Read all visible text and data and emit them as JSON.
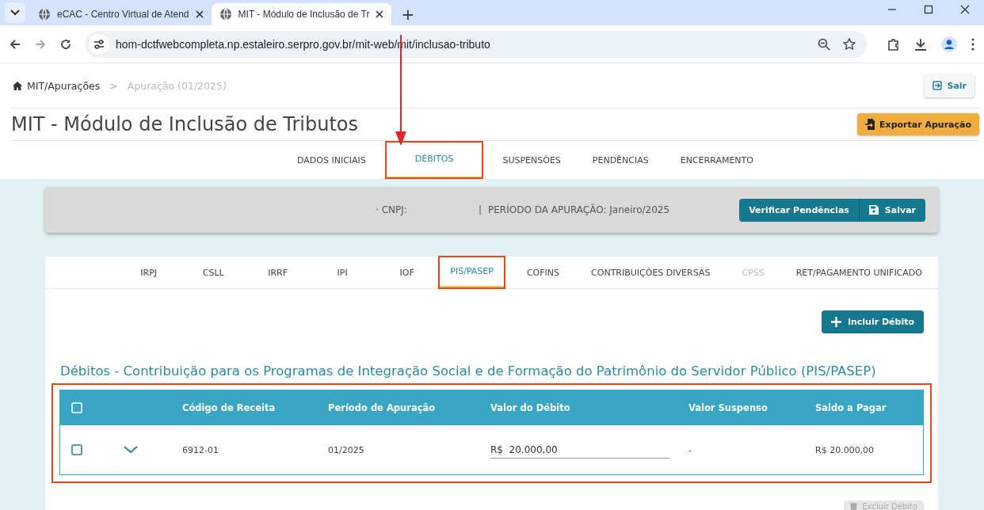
{
  "browser": {
    "tabs": [
      {
        "title": "eCAC - Centro Virtual de Atend",
        "selected": false
      },
      {
        "title": "MIT - Módulo de Inclusão de Tr",
        "selected": true
      }
    ],
    "new_tab": "+",
    "address": "hom-dctfwebcompleta.np.estaleiro.serpro.gov.br/mit-web/mit/inclusao-tributo"
  },
  "breadcrumb": [
    {
      "label": "MIT/Apurações",
      "selected": false
    },
    {
      "label": "Apuração (01/2025)",
      "selected": true
    }
  ],
  "breadcrumb_separator": ">",
  "logout_button": "Sair",
  "title": "MIT - Módulo de Inclusão de Tributos",
  "export_button": "Exportar Apuração",
  "steps": [
    {
      "label": "DADOS INICIAIS",
      "selected": false,
      "highlighted": false
    },
    {
      "label": "DÉBITOS",
      "selected": true,
      "highlighted": true
    },
    {
      "label": "SUSPENSÕES",
      "selected": false,
      "highlighted": false
    },
    {
      "label": "PENDÊNCIAS",
      "selected": false,
      "highlighted": false
    },
    {
      "label": "ENCERRAMENTO",
      "selected": false,
      "highlighted": false
    }
  ],
  "summary": {
    "cnpj": "· CNPJ:",
    "separator": "|",
    "period": "PERÍODO DA APURAÇÃO: Janeiro/2025",
    "buttons": [
      "Verificar Pendências",
      "Salvar"
    ]
  },
  "tributes": [
    {
      "label": "IRPJ",
      "selected": false,
      "disabled": false,
      "highlighted": false
    },
    {
      "label": "CSLL",
      "selected": false,
      "disabled": false,
      "highlighted": false
    },
    {
      "label": "IRRF",
      "selected": false,
      "disabled": false,
      "highlighted": false
    },
    {
      "label": "IPI",
      "selected": false,
      "disabled": false,
      "highlighted": false
    },
    {
      "label": "IOF",
      "selected": false,
      "disabled": false,
      "highlighted": false
    },
    {
      "label": "PIS/PASEP",
      "selected": true,
      "disabled": false,
      "highlighted": true
    },
    {
      "label": "COFINS",
      "selected": false,
      "disabled": false,
      "highlighted": false
    },
    {
      "label": "CONTRIBUIÇÕES DIVERSAS",
      "selected": false,
      "disabled": false,
      "highlighted": false
    },
    {
      "label": "CPSS",
      "selected": false,
      "disabled": true,
      "highlighted": false
    },
    {
      "label": "RET/PAGAMENTO UNIFICADO",
      "selected": false,
      "disabled": false,
      "highlighted": false
    }
  ],
  "add_button": "Incluir Débito",
  "section_title": "Débitos - Contribuição para os Programas de Integração Social e de Formação do Patrimônio do Servidor Público (PIS/PASEP)",
  "table": {
    "highlighted": true,
    "select_all_checked": false,
    "columns": [
      "Código de Receita",
      "Período de Apuração",
      "Valor do Débito",
      "Valor Suspenso",
      "Saldo a Pagar"
    ],
    "rows": [
      {
        "checked": false,
        "expanded": false,
        "code": "6912-01",
        "period": "01/2025",
        "value": "R$  20.000,00",
        "suspended": "-",
        "balance": "R$ 20.000,00"
      }
    ]
  },
  "delete_button": {
    "label": "Excluir Débito",
    "disabled": true
  },
  "annotation_arrow": true
}
